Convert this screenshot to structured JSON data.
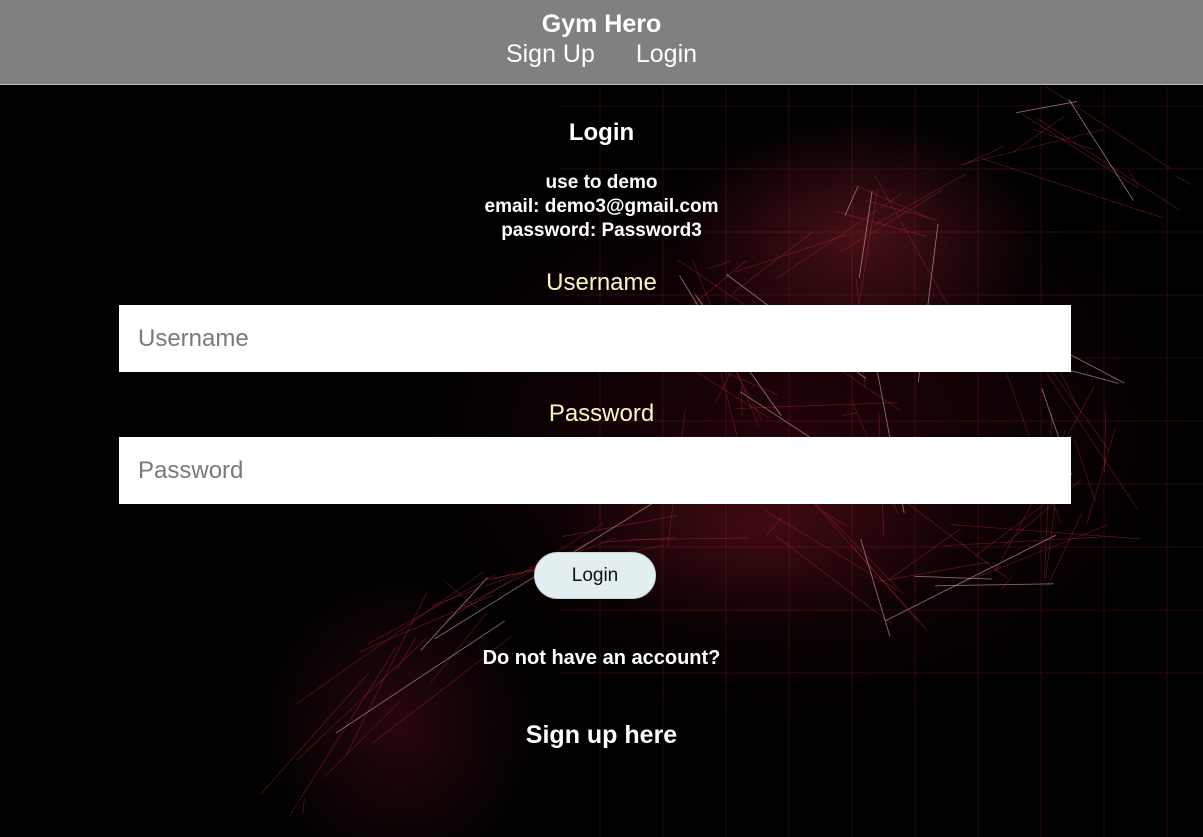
{
  "header": {
    "brand": "Gym Hero",
    "nav": {
      "signup_label": "Sign Up",
      "login_label": "Login"
    }
  },
  "login": {
    "title": "Login",
    "demo_info": {
      "line1": "use to demo",
      "line2": "email: demo3@gmail.com",
      "line3": "password: Password3"
    },
    "username": {
      "label": "Username",
      "placeholder": "Username",
      "value": ""
    },
    "password": {
      "label": "Password",
      "placeholder": "Password",
      "value": ""
    },
    "submit_label": "Login",
    "no_account_text": "Do not have an account?",
    "signup_link_label": "Sign up here"
  },
  "colors": {
    "header_bg": "#808080",
    "label_color": "#fff5c2",
    "button_bg": "#e3eef0",
    "page_bg": "#000000"
  },
  "background_image": "red wireframe runner illustration"
}
